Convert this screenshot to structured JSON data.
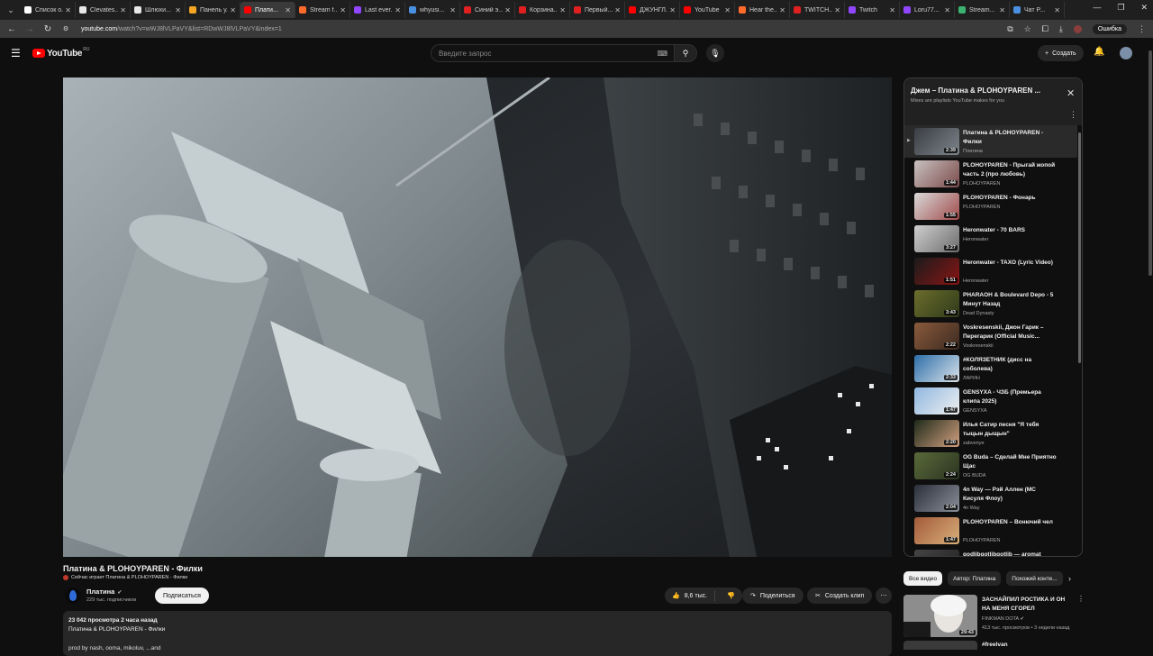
{
  "browser": {
    "tabs": [
      {
        "label": "Список о...",
        "color": "#ffffff"
      },
      {
        "label": "Clevates...",
        "color": "#e8e8e8"
      },
      {
        "label": "Шлюхи...",
        "color": "#e8e8e8"
      },
      {
        "label": "Панель у...",
        "color": "#f5a623"
      },
      {
        "label": "Плати...",
        "color": "#ff0000",
        "active": true
      },
      {
        "label": "Stream f...",
        "color": "#ff6b2b"
      },
      {
        "label": "Last ever...",
        "color": "#9146ff"
      },
      {
        "label": "whyusi...",
        "color": "#4a90e2"
      },
      {
        "label": "Синий э...",
        "color": "#e02020"
      },
      {
        "label": "Корзина...",
        "color": "#e02020"
      },
      {
        "label": "Первый...",
        "color": "#e02020"
      },
      {
        "label": "ДЖУНГЛ...",
        "color": "#ff0000"
      },
      {
        "label": "YouTube",
        "color": "#ff0000"
      },
      {
        "label": "Hear the...",
        "color": "#ff6b2b"
      },
      {
        "label": "TWITCH...",
        "color": "#e02020"
      },
      {
        "label": "Twitch",
        "color": "#9146ff"
      },
      {
        "label": "Loru77...",
        "color": "#9146ff"
      },
      {
        "label": "Stream...",
        "color": "#3cb371"
      },
      {
        "label": "Чат P...",
        "color": "#4a90e2"
      }
    ],
    "url_host": "youtube.com",
    "url_path": "/watch?v=wWJ8lVLPaVY&list=RDwWJ8lVLPaVY&index=1",
    "error_button": "Ошибка"
  },
  "header": {
    "logo_text": "YouTube",
    "logo_region": "RU",
    "search_placeholder": "Введите запрос",
    "create_label": "Создать"
  },
  "video": {
    "title": "Платина & PLOHOYPAREN - Филки",
    "now_playing": "Сейчас играет Платина & PLOHOYPAREN - Филки",
    "channel": "Платина",
    "subscribers": "229 тыс. подписчиков",
    "subscribe_label": "Подписаться",
    "likes": "8,6 тыс.",
    "share_label": "Поделиться",
    "clip_label": "Создать клип",
    "views_date": "23 042 просмотра  2 часа назад",
    "desc_line1": "Платина & PLOHOYPAREN - Филки",
    "desc_line2": "prod by nash, ooma, mikoluv, ...and"
  },
  "playlist": {
    "title": "Джем – Платина & PLOHOYPAREN ...",
    "subtitle": "Mixes are playlists YouTube makes for you",
    "items": [
      {
        "title": "Платина & PLOHOYPAREN - Филки",
        "author": "Платина",
        "duration": "2:39",
        "c1": "#3a3d42",
        "c2": "#7d858c"
      },
      {
        "title": "PLOHOYPAREN - Прыгай жопой часть 2 (про любовь)",
        "author": "PLOHOYPAREN",
        "duration": "1:44",
        "c1": "#c9c2c0",
        "c2": "#7a4a4a"
      },
      {
        "title": "PLOHOYPAREN - Фонарь",
        "author": "PLOHOYPAREN",
        "duration": "1:55",
        "c1": "#d9d9d9",
        "c2": "#a14b4b"
      },
      {
        "title": "Heronwater - 70 BARS",
        "author": "Heronwater",
        "duration": "3:27",
        "c1": "#cfcfcf",
        "c2": "#6c6c6c"
      },
      {
        "title": "Heronwater - TAXO (Lyric Video)",
        "author": "Heronwater",
        "duration": "1:51",
        "c1": "#1b1b1b",
        "c2": "#8a1515"
      },
      {
        "title": "PHARAOH & Boulevard Depo - 5 Минут Назад",
        "author": "Dead Dynasty",
        "duration": "3:43",
        "c1": "#6b6d2c",
        "c2": "#2f3a1a"
      },
      {
        "title": "Voskresenskii, Джон Гарик – Перегарик (Official Music...",
        "author": "Voskresenskii",
        "duration": "2:22",
        "c1": "#8a5a3c",
        "c2": "#3b2a20"
      },
      {
        "title": "#КОЛЯЗЕТНИК (дисс на соболева)",
        "author": "ЛАРИН",
        "duration": "2:33",
        "c1": "#2d6ea8",
        "c2": "#d9e3ea"
      },
      {
        "title": "GENSYXA - ЧЗБ (Премьера клипа 2025)",
        "author": "GENSYXA",
        "duration": "1:47",
        "c1": "#8fb7e0",
        "c2": "#f0f0f0"
      },
      {
        "title": "Илья Сатир песня \"Я тебя тыцын дыщын\"",
        "author": "zabvenye",
        "duration": "2:20",
        "c1": "#1e2a1a",
        "c2": "#d2a080"
      },
      {
        "title": "OG Buda – Сделай Мне Приятно Щас",
        "author": "OG BUDA",
        "duration": "2:24",
        "c1": "#5a6a3a",
        "c2": "#2a3320"
      },
      {
        "title": "4n Way — Рэй Аллен (МС Кисуля Флоу)",
        "author": "4n Way",
        "duration": "2:04",
        "c1": "#2a2f3a",
        "c2": "#8a8f99"
      },
      {
        "title": "PLOHOYPAREN – Вонючий чел",
        "author": "PLOHOYPAREN",
        "duration": "1:47",
        "c1": "#a35a3a",
        "c2": "#d9b07a"
      },
      {
        "title": "godlibgotlibgotlib — aromat",
        "author": "",
        "duration": "",
        "c1": "#444444",
        "c2": "#222222"
      }
    ]
  },
  "chips": [
    "Все видео",
    "Автор: Платина",
    "Похожий конте..."
  ],
  "recommendation": {
    "title": "ЗАСНАЙПИЛ РОСТИКА И ОН НА МЕНЯ СГОРЕЛ",
    "channel": "FINKMAN DOTA",
    "meta": "413 тыс. просмотров • 3 недели назад",
    "duration": "29:43",
    "next_title": "#freelvan"
  }
}
